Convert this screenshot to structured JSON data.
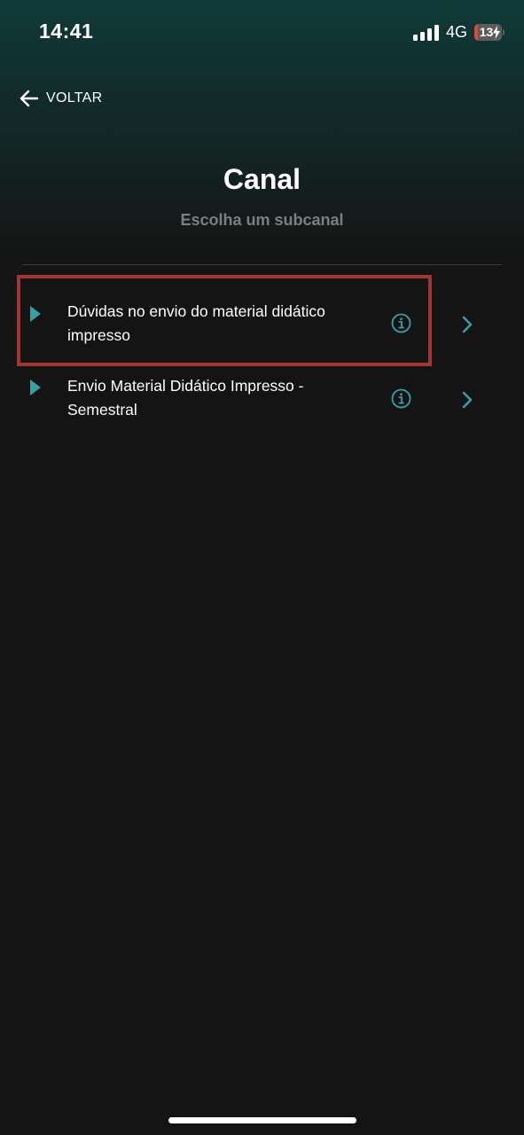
{
  "status_bar": {
    "time": "14:41",
    "network": "4G",
    "battery_level": "13",
    "battery_fraction": 0.13
  },
  "nav": {
    "back_label": "VOLTAR"
  },
  "header": {
    "title": "Canal",
    "subtitle": "Escolha um subcanal"
  },
  "subchannels": [
    {
      "label": "Dúvidas no envio do material didático impresso",
      "highlighted": true
    },
    {
      "label": "Envio Material Didático Impresso - Semestral",
      "highlighted": false
    }
  ],
  "colors": {
    "accent": "#3a9ea3",
    "highlight_border": "#a23434",
    "background": "#141414",
    "header_gradient_top": "#0f3b39",
    "battery_low": "#e5453c"
  },
  "icons": {
    "back": "arrow-left-icon",
    "item": "play-triangle-icon",
    "info": "info-circle-icon",
    "next": "chevron-right-icon"
  }
}
